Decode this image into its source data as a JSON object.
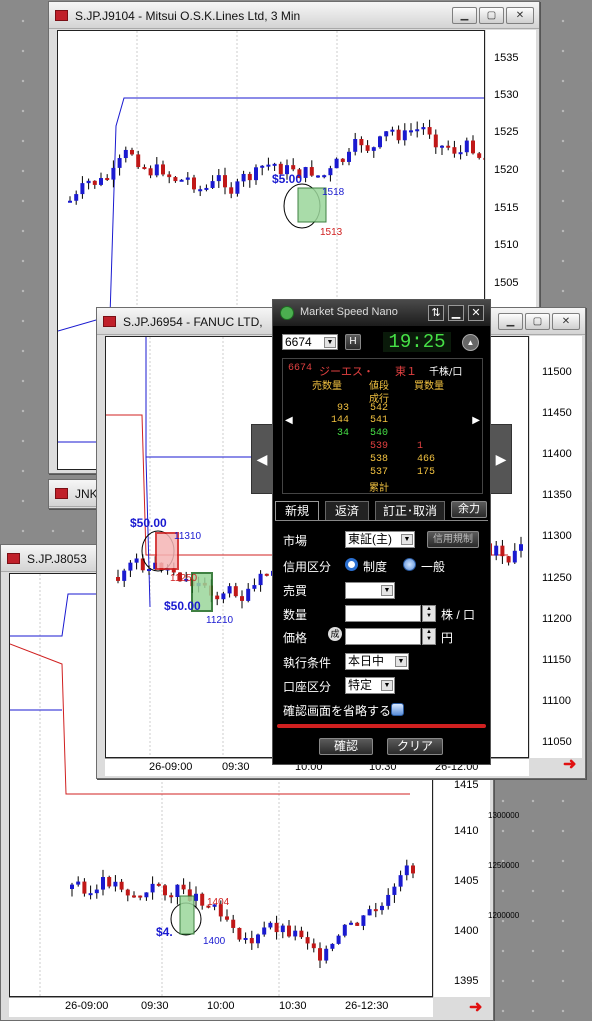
{
  "windows": {
    "w9104": {
      "title": "S.JP.J9104 - Mitsui O.S.K.Lines Ltd, 3 Min",
      "yticks": [
        "1535",
        "1530",
        "1525",
        "1520",
        "1515",
        "1510",
        "1505"
      ],
      "ann": {
        "price_mark": "$5.00",
        "high": "1518",
        "low": "1513"
      }
    },
    "w6954": {
      "title": "S.JP.J6954 - FANUC LTD,",
      "yticks": [
        "11500",
        "11450",
        "11400",
        "11350",
        "11300",
        "11250",
        "11200",
        "11150",
        "11100",
        "11050"
      ],
      "xticks": [
        "26-09:00",
        "09:30",
        "10:00",
        "10:30",
        "26-12:00"
      ],
      "ann": {
        "price_mark1": "$50.00",
        "price_mark2": "$50.00",
        "high": "11310",
        "mid": "11250",
        "low": "11210"
      }
    },
    "w_jnk": {
      "title": "JNK"
    },
    "w8053": {
      "title": "S.JP.J8053",
      "yticks": [
        "1415",
        "1410",
        "1405",
        "1400",
        "1395"
      ],
      "vticks": [
        "1300000",
        "1250000",
        "1200000"
      ],
      "xticks": [
        "26-09:00",
        "09:30",
        "10:00",
        "10:30",
        "26-12:30"
      ],
      "ann": {
        "price_mark": "$4.",
        "high": "1404",
        "low": "1400"
      }
    }
  },
  "nano": {
    "title": "Market Speed Nano",
    "code": "6674",
    "h_button": "H",
    "time": "19:25",
    "board_header": {
      "code": "6674",
      "name": "ジーエス・",
      "market": "東１",
      "unit": "千株/口"
    },
    "board_cols": {
      "sell": "売数量",
      "price": "値段",
      "buy": "買数量"
    },
    "market_order": "成行",
    "asks": [
      {
        "qty": "93",
        "price": "542"
      },
      {
        "qty": "144",
        "price": "541"
      },
      {
        "qty": "34",
        "price": "540"
      }
    ],
    "bids": [
      {
        "price": "539",
        "qty": "1"
      },
      {
        "price": "538",
        "qty": "466"
      },
      {
        "price": "537",
        "qty": "175"
      }
    ],
    "total": "累計",
    "tabs": [
      "新規",
      "返済",
      "訂正･取消"
    ],
    "yoryoku": "余力",
    "fields": {
      "market_label": "市場",
      "market_value": "東証(主)",
      "rules_button": "信用規制",
      "credit_label": "信用区分",
      "credit_opt1": "制度",
      "credit_opt2": "一般",
      "side_label": "売買",
      "side_value": "",
      "qty_label": "数量",
      "qty_unit": "株 / 口",
      "price_label": "価格",
      "nari": "成",
      "price_unit": "円",
      "cond_label": "執行条件",
      "cond_value": "本日中",
      "account_label": "口座区分",
      "account_value": "特定",
      "skip_confirm": "確認画面を省略する"
    },
    "confirm_button": "確認",
    "clear_button": "クリア"
  }
}
